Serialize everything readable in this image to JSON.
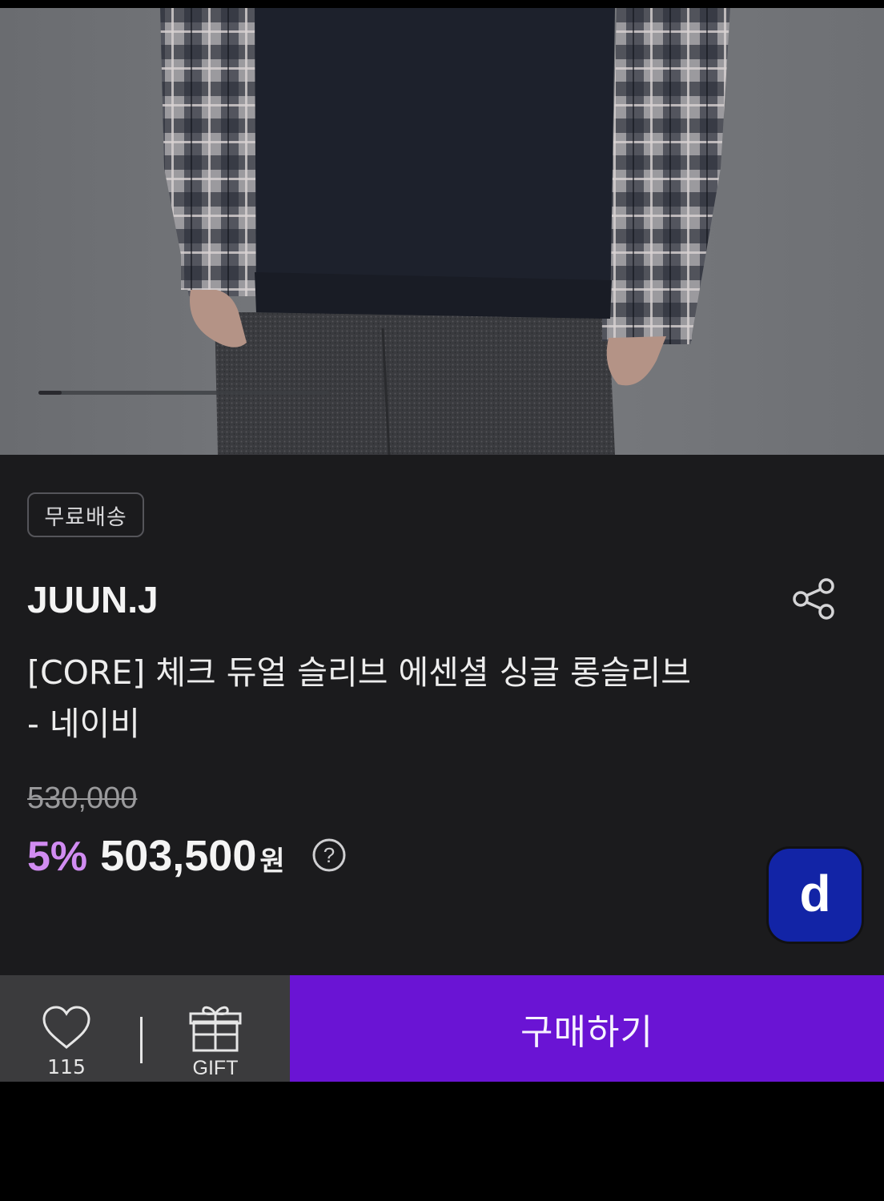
{
  "product": {
    "shipping_badge": "무료배송",
    "brand": "JUUN.J",
    "title": "[CORE] 체크 듀얼 슬리브 에센셜 싱글 롱슬리브 - 네이비",
    "original_price": "530,000",
    "discount": "5%",
    "price": "503,500",
    "currency": "원",
    "help_symbol": "?"
  },
  "gallery": {
    "image_index_fraction": 0.08
  },
  "floating_button": {
    "label": "d",
    "color": "#1224a6"
  },
  "bottom_bar": {
    "like_count": "115",
    "gift_label": "GIFT",
    "buy_label": "구매하기",
    "buy_color": "#6a14d4"
  },
  "colors": {
    "discount_accent": "#d18cf2",
    "background": "#1b1b1d"
  },
  "icons": [
    "share-icon",
    "help-icon",
    "heart-icon",
    "gift-icon"
  ]
}
